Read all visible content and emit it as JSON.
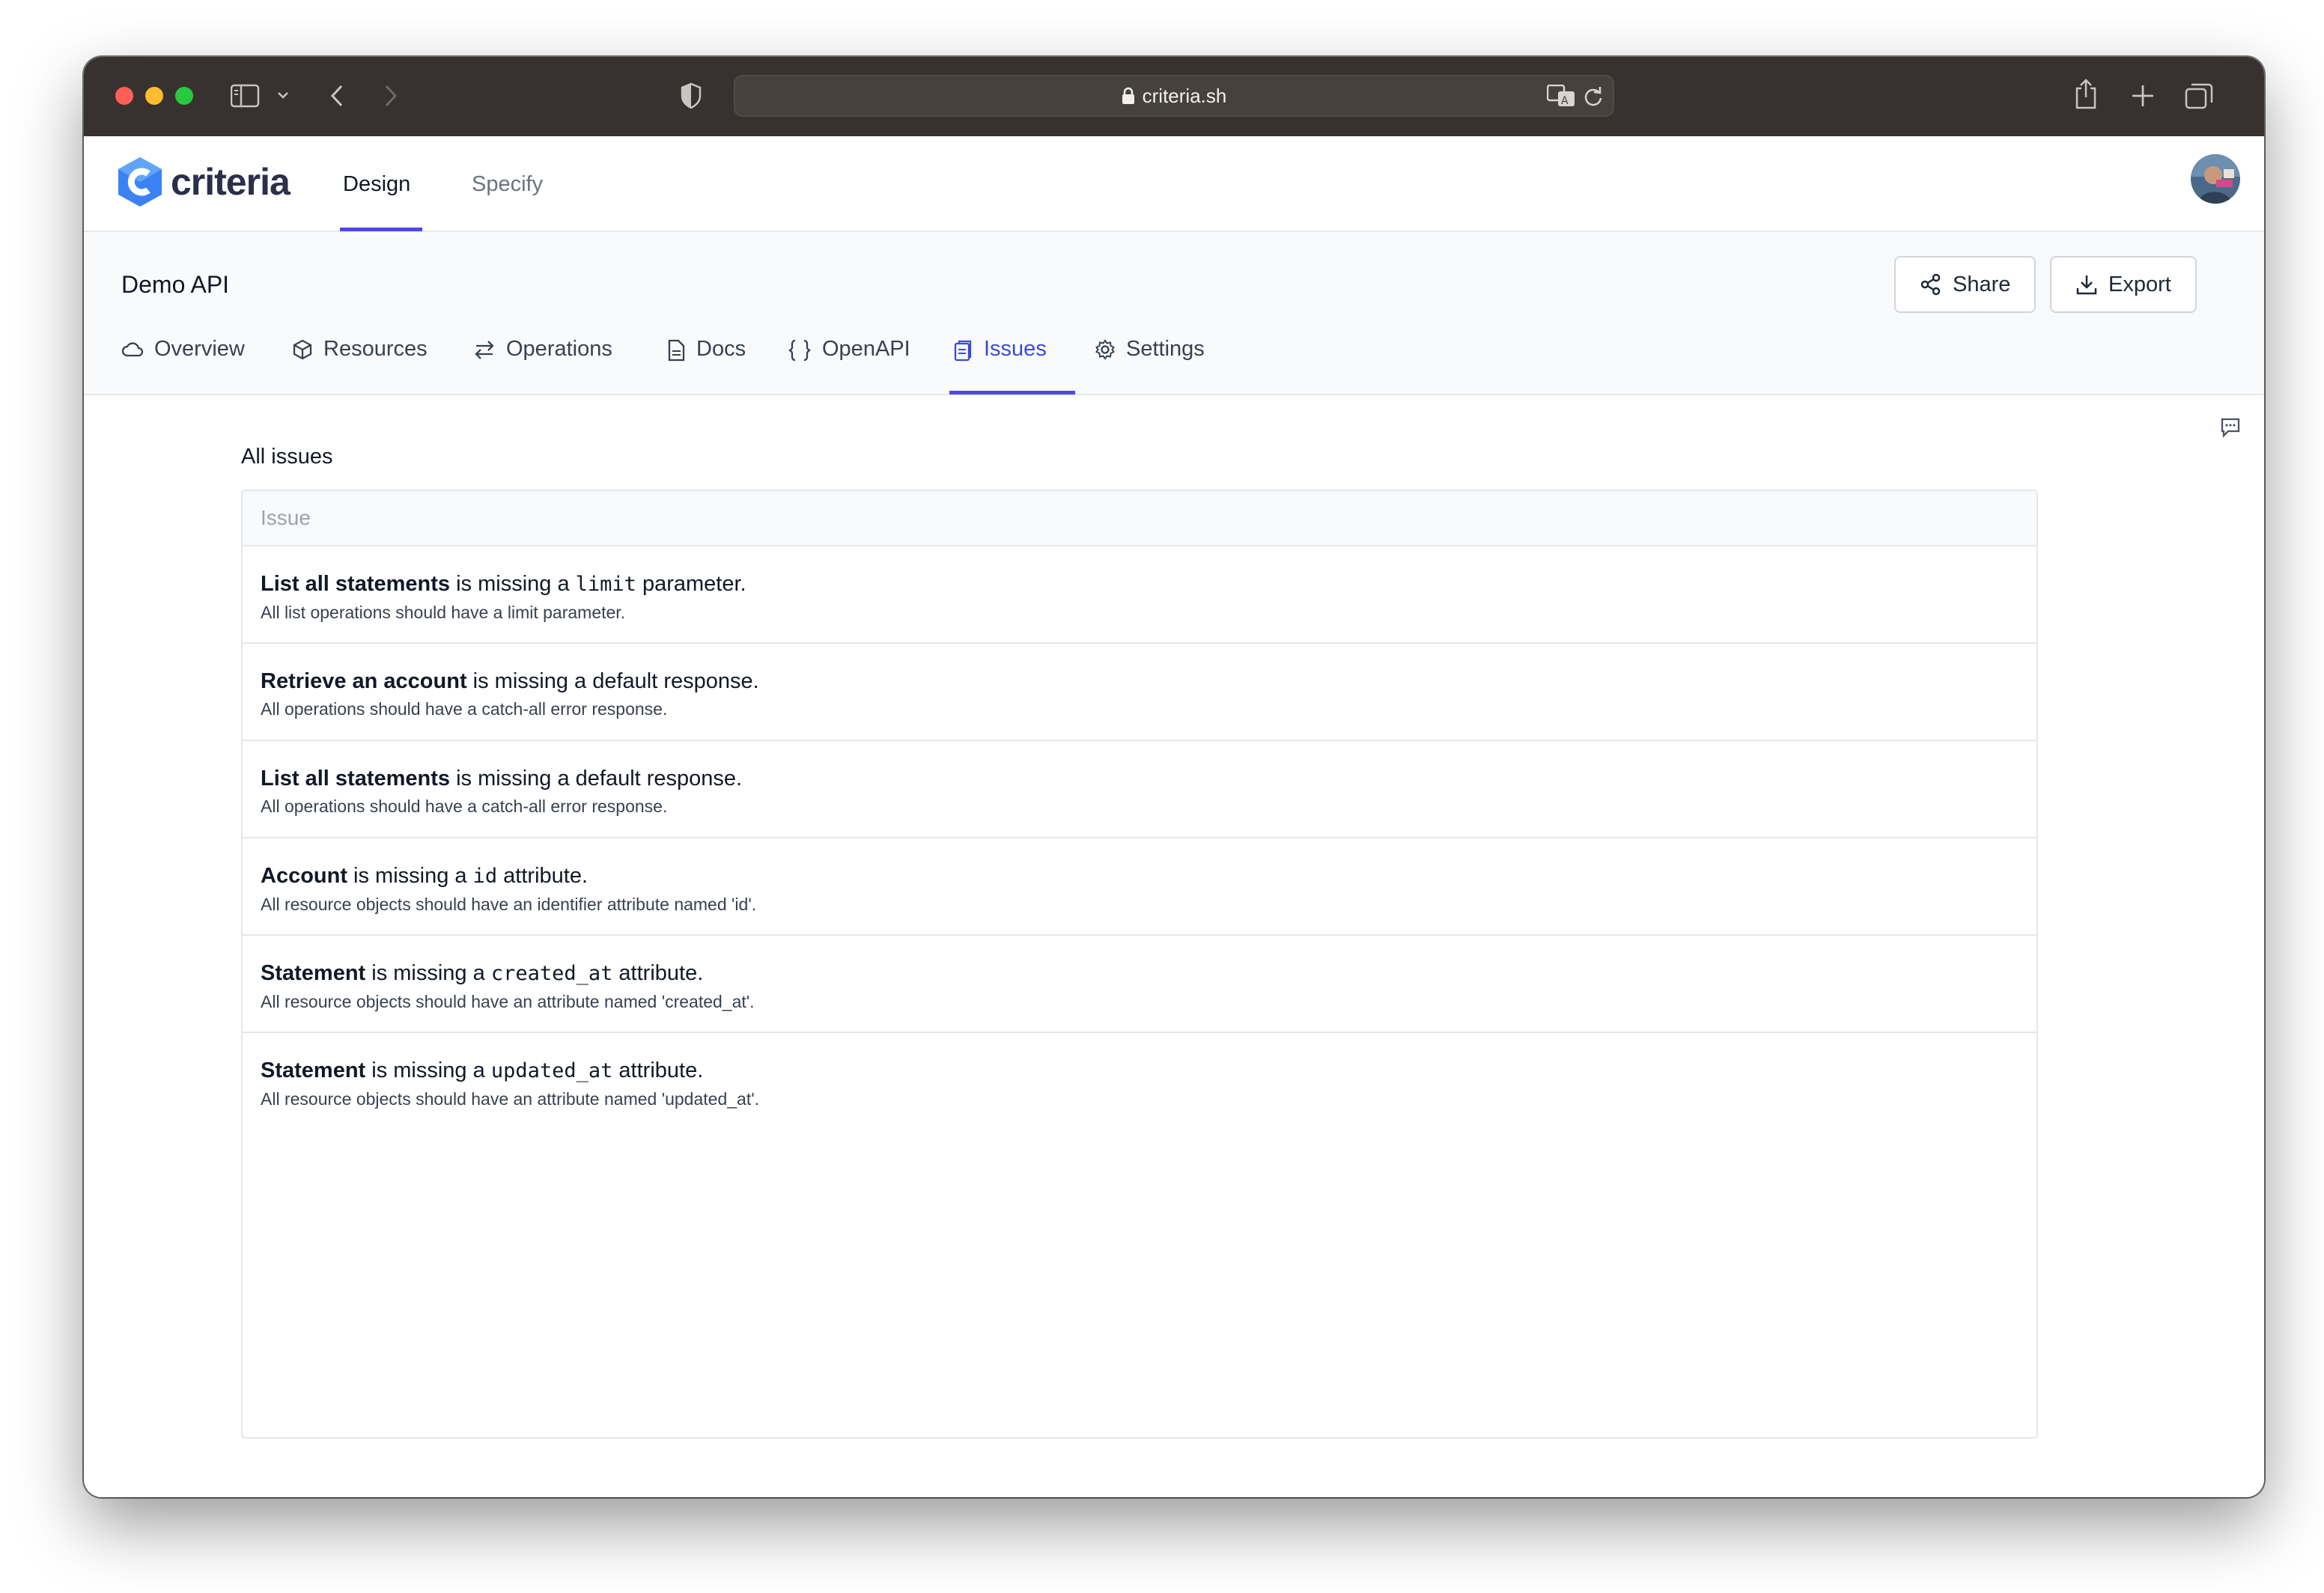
{
  "browser": {
    "url": "criteria.sh"
  },
  "app": {
    "logo_text": "criteria",
    "nav": [
      {
        "label": "Design",
        "active": true
      },
      {
        "label": "Specify",
        "active": false
      }
    ]
  },
  "project": {
    "title": "Demo API",
    "share_label": "Share",
    "export_label": "Export",
    "tabs": [
      {
        "label": "Overview",
        "icon": "cloud-icon"
      },
      {
        "label": "Resources",
        "icon": "cube-icon"
      },
      {
        "label": "Operations",
        "icon": "arrows-exchange-icon"
      },
      {
        "label": "Docs",
        "icon": "document-icon"
      },
      {
        "label": "OpenAPI",
        "icon": "braces-icon"
      },
      {
        "label": "Issues",
        "icon": "clipboard-icon",
        "active": true
      },
      {
        "label": "Settings",
        "icon": "gear-icon"
      }
    ]
  },
  "issues": {
    "section_title": "All issues",
    "column_header": "Issue",
    "rows": [
      {
        "subject": "List all statements",
        "pre": " is missing a ",
        "code": "limit",
        "post": " parameter.",
        "description": "All list operations should have a limit parameter."
      },
      {
        "subject": "Retrieve an account",
        "pre": " is missing a default response.",
        "code": "",
        "post": "",
        "description": "All operations should have a catch-all error response."
      },
      {
        "subject": "List all statements",
        "pre": " is missing a default response.",
        "code": "",
        "post": "",
        "description": "All operations should have a catch-all error response."
      },
      {
        "subject": "Account",
        "pre": " is missing a ",
        "code": "id",
        "post": " attribute.",
        "description": "All resource objects should have an identifier attribute named 'id'."
      },
      {
        "subject": "Statement",
        "pre": " is missing a ",
        "code": "created_at",
        "post": " attribute.",
        "description": "All resource objects should have an attribute named 'created_at'."
      },
      {
        "subject": "Statement",
        "pre": " is missing a ",
        "code": "updated_at",
        "post": " attribute.",
        "description": "All resource objects should have an attribute named 'updated_at'."
      }
    ]
  },
  "colors": {
    "accent": "#4f46e5",
    "titlebar": "#37322f",
    "logo_blue": "#3b82f6"
  }
}
